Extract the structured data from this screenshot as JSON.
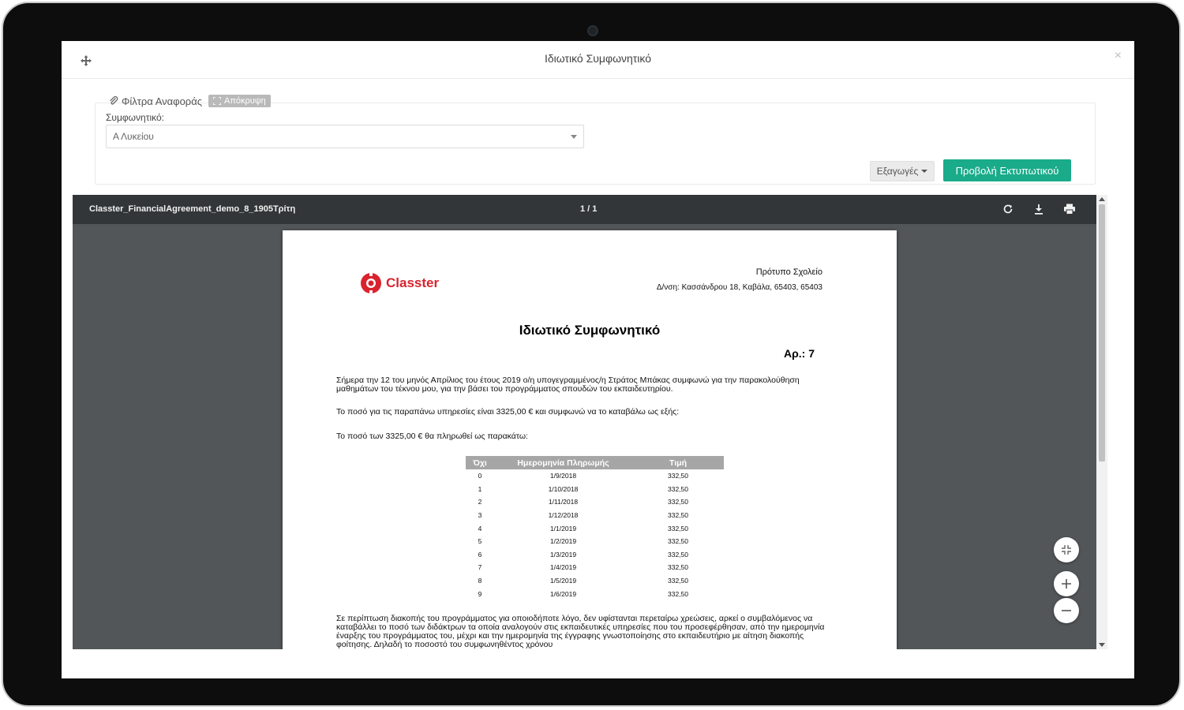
{
  "modal": {
    "title": "Ιδιωτικό Συμφωνητικό",
    "move_icon": "move-icon",
    "close_label": "×"
  },
  "filters": {
    "legend_label": "Φίλτρα Αναφοράς",
    "hide_label": "Απόκρυψη",
    "agreement_label": "Συμφωνητικό:",
    "agreement_value": "Α Λυκείου"
  },
  "actions": {
    "export_label": "Εξαγωγές",
    "print_preview_label": "Προβολή Εκτυπωτικού",
    "primary_color": "#1aab8a"
  },
  "viewer": {
    "filename": "Classter_FinancialAgreement_demo_8_1905Τρίτη",
    "page_count": "1 / 1",
    "icons": [
      "rotate-icon",
      "download-icon",
      "print-icon",
      "fit-page-icon",
      "zoom-in-icon",
      "zoom-out-icon"
    ]
  },
  "document": {
    "logo_text": "Classter",
    "brand_color": "#d9232e",
    "school_name": "Πρότυπο Σχολείο",
    "school_address": "Δ/νση: Κασσάνδρου 18, Καβάλα, 65403, 65403",
    "title": "Ιδιωτικό Συμφωνητικό",
    "number": "Αρ.: 7",
    "paragraph1": "Σήμερα την 12 του μηνός Απρίλιος του έτους 2019 ο/η υπογεγραμμένος/η Στράτος Μπάκας συμφωνώ για την παρακολούθηση μαθημάτων του τέκνου μου, για την  βάσει του προγράμματος σπουδών του εκπαιδευτηρίου.",
    "paragraph2": "Το ποσό για τις παραπάνω υπηρεσίες είναι 3325,00 € και συμφωνώ να το καταβάλω ως εξής:",
    "paragraph3": "Το ποσό των 3325,00 € θα πληρωθεί ως παρακάτω:",
    "table_headers": [
      "Όχι",
      "Ημερομηνία Πληρωμής",
      "Τιμή"
    ],
    "table_rows": [
      [
        "0",
        "1/9/2018",
        "332,50"
      ],
      [
        "1",
        "1/10/2018",
        "332,50"
      ],
      [
        "2",
        "1/11/2018",
        "332,50"
      ],
      [
        "3",
        "1/12/2018",
        "332,50"
      ],
      [
        "4",
        "1/1/2019",
        "332,50"
      ],
      [
        "5",
        "1/2/2019",
        "332,50"
      ],
      [
        "6",
        "1/3/2019",
        "332,50"
      ],
      [
        "7",
        "1/4/2019",
        "332,50"
      ],
      [
        "8",
        "1/5/2019",
        "332,50"
      ],
      [
        "9",
        "1/6/2019",
        "332,50"
      ]
    ],
    "paragraph4": "Σε περίπτωση διακοπής του προγράμματος για οποιοδήποτε λόγο, δεν υφίστανται περεταίρω χρεώσεις, αρκεί ο συμβαλόμενος να καταβάλλει το ποσό των διδάκτρων τα οποία αναλογούν στις εκπαιδευτικές υπηρεσίες που του προσεφέρθησαν, από την ημερομηνία έναρξης του προγράμματος του, μέχρι και την ημερομηνία της έγγραφης γνωστοποίησης στο εκπαιδευτήριο με αίτηση διακοπής φοίτησης. Δηλαδή το ποσοστό του συμφωνηθέντος χρόνου"
  }
}
